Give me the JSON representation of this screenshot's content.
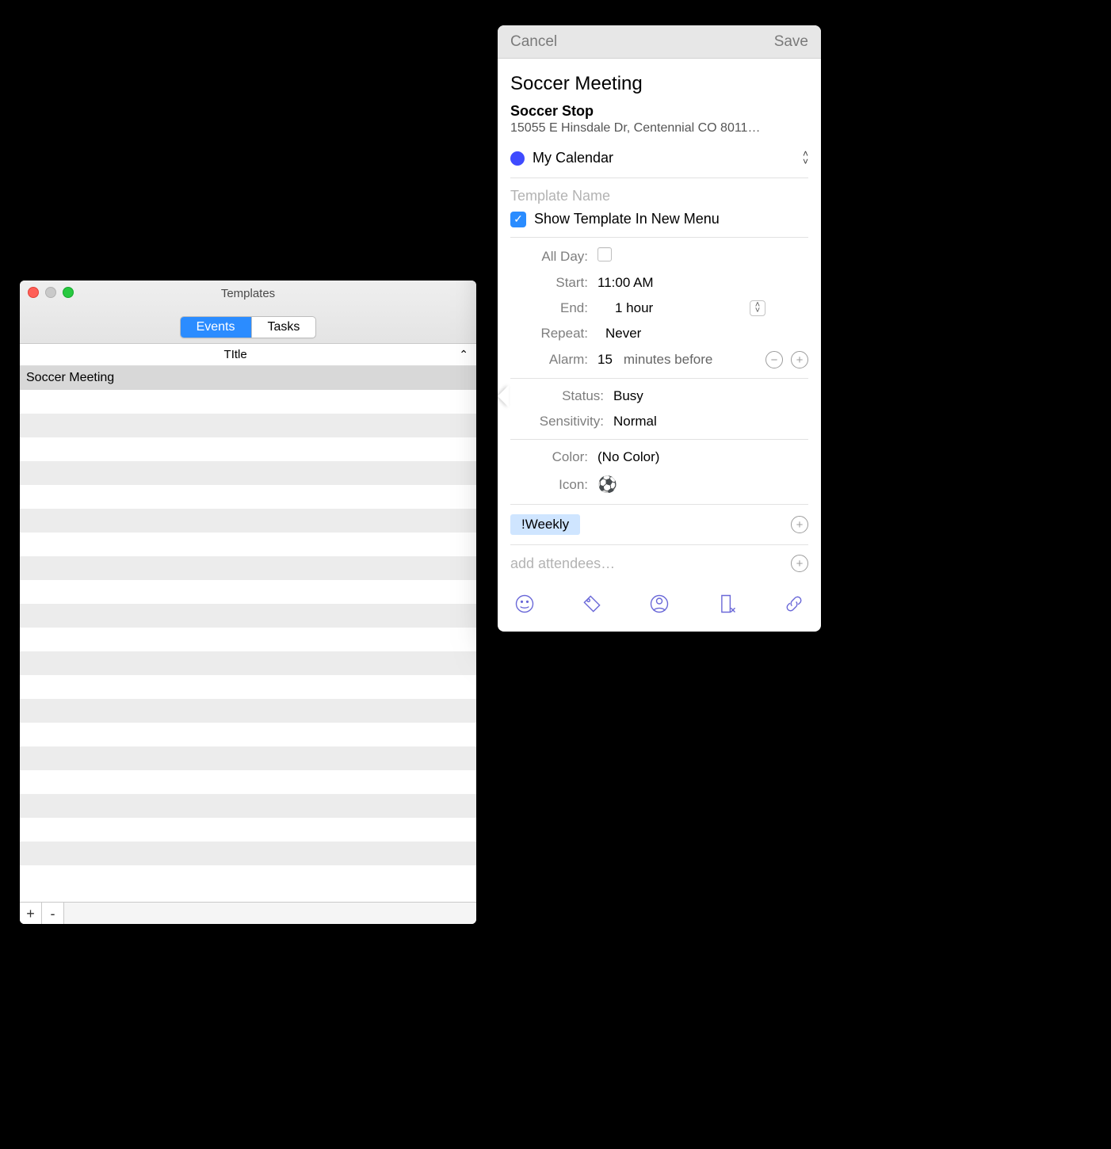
{
  "templates_window": {
    "title": "Templates",
    "tabs": {
      "events": "Events",
      "tasks": "Tasks"
    },
    "column_header": "TItle",
    "rows": [
      "Soccer Meeting"
    ],
    "footer": {
      "add": "+",
      "remove": "-"
    }
  },
  "event_editor": {
    "toolbar": {
      "cancel": "Cancel",
      "save": "Save"
    },
    "title": "Soccer Meeting",
    "location": {
      "name": "Soccer Stop",
      "address": "15055 E Hinsdale Dr, Centennial CO 8011…"
    },
    "calendar": {
      "name": "My Calendar",
      "color": "#3f4bff"
    },
    "template": {
      "name_placeholder": "Template Name",
      "show_in_menu_label": "Show Template In New Menu",
      "show_in_menu_checked": true
    },
    "timing": {
      "all_day_label": "All Day:",
      "all_day_checked": false,
      "start_label": "Start:",
      "start_value": "11:00 AM",
      "end_label": "End:",
      "end_value": "1 hour",
      "repeat_label": "Repeat:",
      "repeat_value": "Never",
      "alarm_label": "Alarm:",
      "alarm_value": "15",
      "alarm_unit": "minutes before"
    },
    "status": {
      "status_label": "Status:",
      "status_value": "Busy",
      "sensitivity_label": "Sensitivity:",
      "sensitivity_value": "Normal"
    },
    "appearance": {
      "color_label": "Color:",
      "color_value": "(No Color)",
      "icon_label": "Icon:",
      "icon_emoji": "⚽"
    },
    "tags": [
      "!Weekly"
    ],
    "attendees_placeholder": "add attendees…"
  }
}
